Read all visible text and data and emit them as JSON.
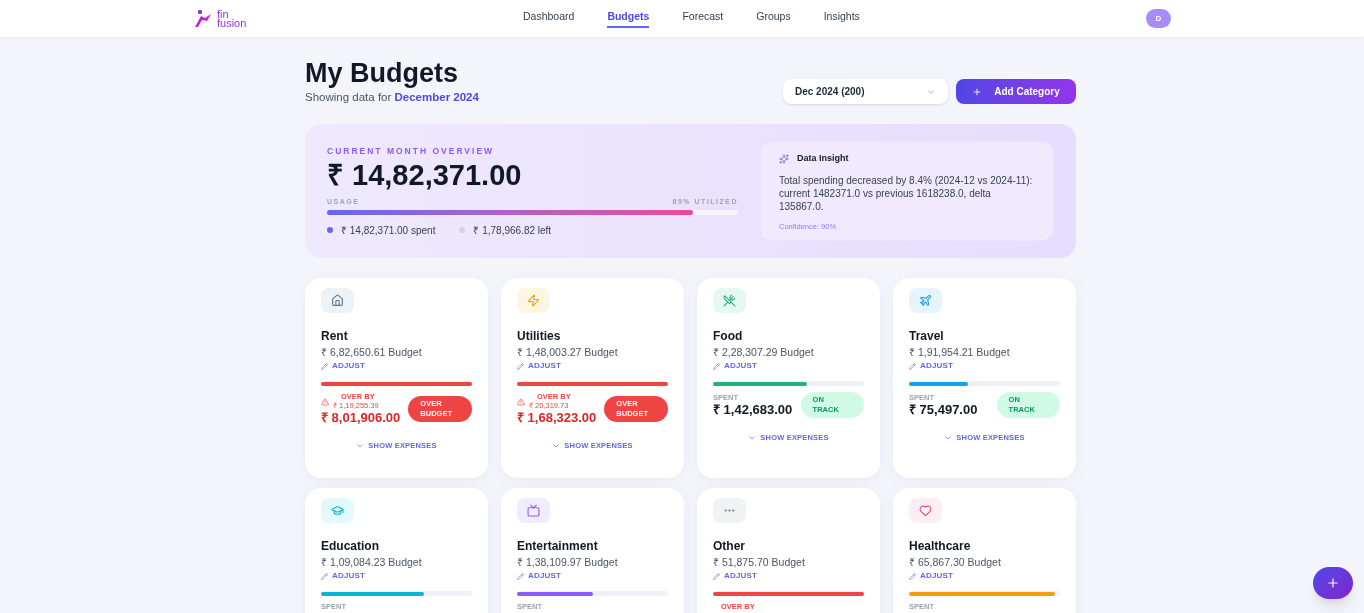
{
  "nav": {
    "logo_top": "fin",
    "logo_bottom": "fusion",
    "links": [
      {
        "label": "Dashboard",
        "selected": false
      },
      {
        "label": "Budgets",
        "selected": true
      },
      {
        "label": "Forecast",
        "selected": false
      },
      {
        "label": "Groups",
        "selected": false
      },
      {
        "label": "Insights",
        "selected": false
      }
    ],
    "avatar": "D"
  },
  "header": {
    "title": "My Budgets",
    "subtitle": "Showing data for",
    "period": "December 2024",
    "month_select": "Dec 2024 (200)",
    "add_button": "Add Category"
  },
  "overview": {
    "eyebrow": "CURRENT MONTH OVERVIEW",
    "total": "₹ 14,82,371.00",
    "usage_label": "USAGE",
    "utilized": "89% UTILIZED",
    "level": 0.89,
    "spent": "₹ 14,82,371.00 spent",
    "left": "₹ 1,78,966.82 left",
    "insight": {
      "title": "Data Insight",
      "text": "Total spending decreased by 8.4% (2024-12 vs 2024-11): current 1482371.0 vs previous 1618238.0, delta 135867.0.",
      "confidence": "Confidence: 90%"
    }
  },
  "categories": [
    {
      "kind": "home",
      "name": "Rent",
      "budget": "₹ 6,82,650.61 Budget",
      "adjust": "ADJUST",
      "level": 1,
      "color": "#ef4444",
      "over_budget": true,
      "label": "OVER BY",
      "over_by": "₹ 1,19,255.39",
      "amount": "₹ 8,01,906.00",
      "badge": "OVER BUDGET",
      "expenses": "SHOW EXPENSES"
    },
    {
      "kind": "bolt",
      "name": "Utilities",
      "budget": "₹ 1,48,003.27 Budget",
      "adjust": "ADJUST",
      "level": 1,
      "color": "#ef4444",
      "over_budget": true,
      "label": "OVER BY",
      "over_by": "₹ 20,319.73",
      "amount": "₹ 1,68,323.00",
      "badge": "OVER BUDGET",
      "expenses": "SHOW EXPENSES"
    },
    {
      "kind": "food",
      "name": "Food",
      "budget": "₹ 2,28,307.29 Budget",
      "adjust": "ADJUST",
      "level": 0.62,
      "color": "#22b07d",
      "over_budget": false,
      "label": "SPENT",
      "amount": "₹ 1,42,683.00",
      "badge": "ON TRACK",
      "expenses": "SHOW EXPENSES"
    },
    {
      "kind": "plane",
      "name": "Travel",
      "budget": "₹ 1,91,954.21 Budget",
      "adjust": "ADJUST",
      "level": 0.39,
      "color": "#0ea5e9",
      "over_budget": false,
      "label": "SPENT",
      "amount": "₹ 75,497.00",
      "badge": "ON TRACK",
      "expenses": "SHOW EXPENSES"
    },
    {
      "kind": "cap",
      "name": "Education",
      "budget": "₹ 1,09,084.23 Budget",
      "adjust": "ADJUST",
      "level": 0.68,
      "color": "#06b6d4",
      "over_budget": false,
      "label": "SPENT"
    },
    {
      "kind": "tv",
      "name": "Entertainment",
      "budget": "₹ 1,38,109.97 Budget",
      "adjust": "ADJUST",
      "level": 0.5,
      "color": "#8b5cf6",
      "over_budget": false,
      "label": "SPENT"
    },
    {
      "kind": "dots",
      "name": "Other",
      "budget": "₹ 51,875.70 Budget",
      "adjust": "ADJUST",
      "level": 1,
      "color": "#ef4444",
      "over_budget": true,
      "label": "OVER BY"
    },
    {
      "kind": "heart",
      "name": "Healthcare",
      "budget": "₹ 65,867.30 Budget",
      "adjust": "ADJUST",
      "level": 0.97,
      "color": "#f59e0b",
      "over_budget": false,
      "label": "SPENT"
    }
  ]
}
